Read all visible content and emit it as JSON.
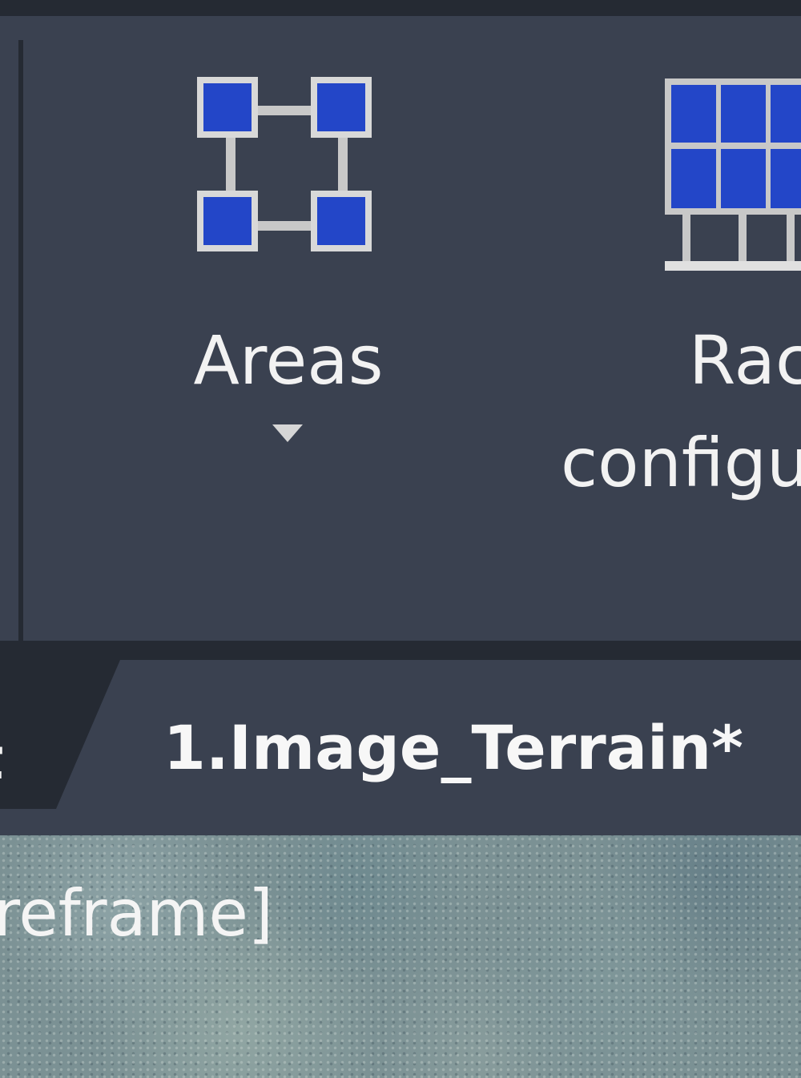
{
  "ribbon": {
    "areas": {
      "label": "Areas",
      "icon": "areas-icon",
      "has_dropdown": true
    },
    "racks": {
      "label_line1": "Rac",
      "label_line2": "configu",
      "icon": "rack-configuration-icon"
    }
  },
  "tabs": {
    "previous_tab_fragment": "t",
    "active_tab_label": "1.Image_Terrain*"
  },
  "viewport": {
    "label": "ireframe]"
  },
  "colors": {
    "ribbon_bg": "#3a4150",
    "dark_strip": "#252a33",
    "icon_blue": "#2346c8",
    "icon_frame": "#c8c8c8",
    "text": "#f2f2f2"
  }
}
